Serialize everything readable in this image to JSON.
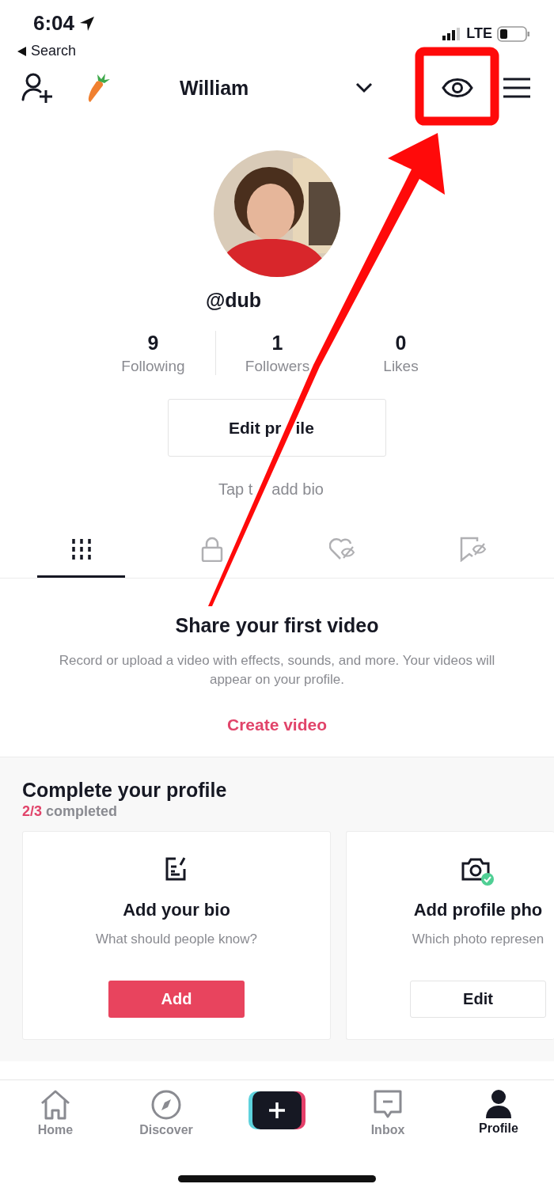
{
  "status_bar": {
    "time": "6:04",
    "back_label": "Search",
    "network": "LTE"
  },
  "header": {
    "name": "William"
  },
  "profile": {
    "username": "@dub",
    "stats": [
      {
        "value": "9",
        "label": "Following"
      },
      {
        "value": "1",
        "label": "Followers"
      },
      {
        "value": "0",
        "label": "Likes"
      }
    ],
    "edit_button_parts": [
      "Edit pr",
      "ile"
    ],
    "bio_hint_parts": [
      "Tap t",
      "add bio"
    ]
  },
  "tabs": [
    {
      "kind": "grid",
      "selected": true
    },
    {
      "kind": "lock",
      "selected": false
    },
    {
      "kind": "liked",
      "selected": false
    },
    {
      "kind": "saved",
      "selected": false
    }
  ],
  "empty_state": {
    "title": "Share your first video",
    "text": "Record or upload a video with effects, sounds, and more. Your videos will appear on your profile.",
    "action": "Create video"
  },
  "complete_profile": {
    "title": "Complete your profile",
    "count": "2/3",
    "count_label": "completed",
    "cards": [
      {
        "kind": "bio",
        "title": "Add your bio",
        "text": "What should people know?",
        "button": "Add",
        "done": false
      },
      {
        "title": "Add profile pho",
        "text": "Which photo represen",
        "button": "Edit",
        "done": true
      }
    ]
  },
  "nav": [
    {
      "kind": "home",
      "label": "Home",
      "selected": false
    },
    {
      "kind": "discover",
      "label": "Discover",
      "selected": false
    },
    {
      "kind": "create",
      "selected": false
    },
    {
      "kind": "inbox",
      "label": "Inbox",
      "selected": false
    },
    {
      "kind": "profile",
      "label": "Profile",
      "selected": true
    }
  ]
}
